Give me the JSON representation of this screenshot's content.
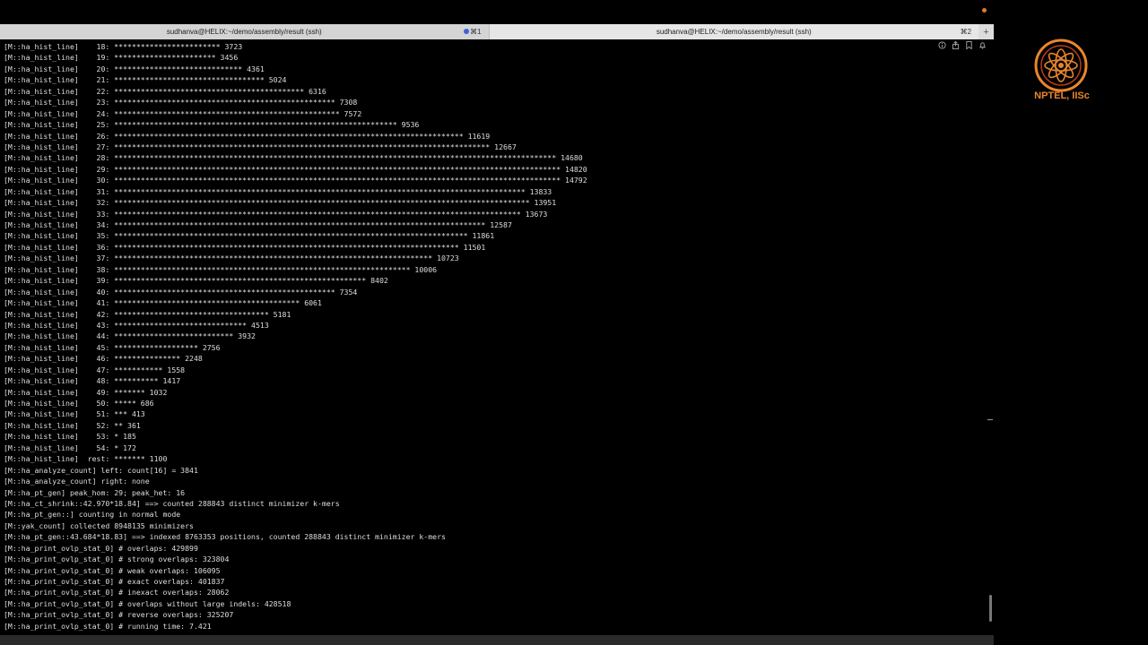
{
  "tabs": [
    {
      "title": "sudhanva@HELIX:~/demo/assembly/result (ssh)",
      "shortcut": "⌘1"
    },
    {
      "title": "sudhanva@HELIX:~/demo/assembly/result (ssh)",
      "shortcut": "⌘2"
    }
  ],
  "new_tab_label": "+",
  "toolbar_icons": [
    "info-icon",
    "share-icon",
    "bookmark-icon",
    "bell-icon"
  ],
  "terminal_lines": [
    "[M::ha_hist_line]    18: ************************ 3723",
    "[M::ha_hist_line]    19: *********************** 3456",
    "[M::ha_hist_line]    20: ***************************** 4361",
    "[M::ha_hist_line]    21: ********************************** 5024",
    "[M::ha_hist_line]    22: ******************************************* 6316",
    "[M::ha_hist_line]    23: ************************************************** 7308",
    "[M::ha_hist_line]    24: *************************************************** 7572",
    "[M::ha_hist_line]    25: **************************************************************** 9536",
    "[M::ha_hist_line]    26: ******************************************************************************* 11619",
    "[M::ha_hist_line]    27: ************************************************************************************* 12667",
    "[M::ha_hist_line]    28: **************************************************************************************************** 14680",
    "[M::ha_hist_line]    29: ***************************************************************************************************** 14820",
    "[M::ha_hist_line]    30: ***************************************************************************************************** 14792",
    "[M::ha_hist_line]    31: ********************************************************************************************* 13833",
    "[M::ha_hist_line]    32: ********************************************************************************************** 13951",
    "[M::ha_hist_line]    33: ******************************************************************************************** 13673",
    "[M::ha_hist_line]    34: ************************************************************************************ 12587",
    "[M::ha_hist_line]    35: ******************************************************************************** 11861",
    "[M::ha_hist_line]    36: ****************************************************************************** 11501",
    "[M::ha_hist_line]    37: ************************************************************************ 10723",
    "[M::ha_hist_line]    38: ******************************************************************* 10006",
    "[M::ha_hist_line]    39: ********************************************************* 8402",
    "[M::ha_hist_line]    40: ************************************************** 7354",
    "[M::ha_hist_line]    41: ****************************************** 6061",
    "[M::ha_hist_line]    42: *********************************** 5181",
    "[M::ha_hist_line]    43: ****************************** 4513",
    "[M::ha_hist_line]    44: *************************** 3932",
    "[M::ha_hist_line]    45: ******************* 2756",
    "[M::ha_hist_line]    46: *************** 2248",
    "[M::ha_hist_line]    47: *********** 1558",
    "[M::ha_hist_line]    48: ********** 1417",
    "[M::ha_hist_line]    49: ******* 1032",
    "[M::ha_hist_line]    50: ***** 686",
    "[M::ha_hist_line]    51: *** 413",
    "[M::ha_hist_line]    52: ** 361",
    "[M::ha_hist_line]    53: * 185",
    "[M::ha_hist_line]    54: * 172",
    "[M::ha_hist_line]  rest: ******* 1100",
    "[M::ha_analyze_count] left: count[16] = 3841",
    "[M::ha_analyze_count] right: none",
    "[M::ha_pt_gen] peak_hom: 29; peak_het: 16",
    "[M::ha_ct_shrink::42.970*18.84] ==> counted 288843 distinct minimizer k-mers",
    "[M::ha_pt_gen::] counting in normal mode",
    "[M::yak_count] collected 8948135 minimizers",
    "[M::ha_pt_gen::43.684*18.83] ==> indexed 8763353 positions, counted 288843 distinct minimizer k-mers",
    "[M::ha_print_ovlp_stat_0] # overlaps: 429899",
    "[M::ha_print_ovlp_stat_0] # strong overlaps: 323804",
    "[M::ha_print_ovlp_stat_0] # weak overlaps: 106095",
    "[M::ha_print_ovlp_stat_0] # exact overlaps: 401837",
    "[M::ha_print_ovlp_stat_0] # inexact overlaps: 28062",
    "[M::ha_print_ovlp_stat_0] # overlaps without large indels: 428518",
    "[M::ha_print_ovlp_stat_0] # reverse overlaps: 325207",
    "[M::ha_print_ovlp_stat_0] # running time: 7.421"
  ],
  "logo": {
    "text": "NPTEL, IISc",
    "color": "#e8862e"
  }
}
